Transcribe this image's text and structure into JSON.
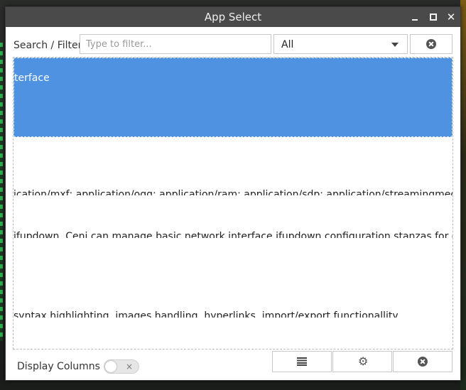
{
  "window": {
    "title": "App Select",
    "controls": {
      "minimize": "minimize",
      "maximize": "maximize",
      "close": "✕"
    }
  },
  "toolbar": {
    "search_label": "Search / Filter:",
    "search_placeholder": "Type to filter...",
    "search_value": "",
    "filter_selected": "All"
  },
  "list": {
    "rows": [
      {
        "text": "terface",
        "selected": true
      },
      {
        "text": "ication/mxf; application/ogg; application/ram; application/sdp; application/streamingmedia; applica",
        "selected": false
      },
      {
        "text": "ifupdown. Ceni can manage basic network interface ifupdown configuration stanzas for ethernet an",
        "selected": false
      },
      {
        "text": " syntax highlighting, images handling, hyperlinks, import/export functionallity",
        "selected": false
      }
    ]
  },
  "bottombar": {
    "display_columns_label": "Display Columns",
    "toggle_on": false,
    "toggle_off_glyph": "×"
  },
  "icons": {
    "clear_filter": "close-circle-icon",
    "list_view": "list-icon",
    "settings": "gear-icon",
    "quit": "close-circle-icon"
  },
  "colors": {
    "selection": "#4f92e2",
    "titlebar": "#4a4a4a"
  }
}
